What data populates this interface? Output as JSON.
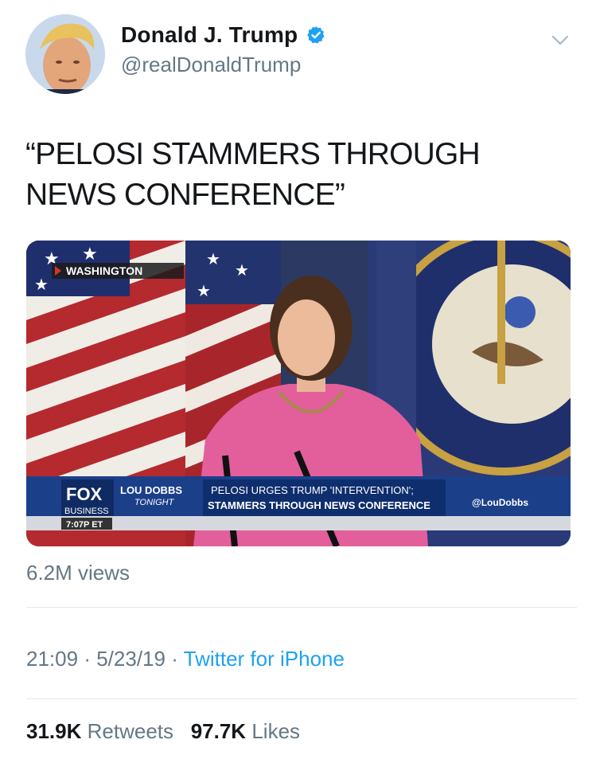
{
  "author": {
    "display_name": "Donald J. Trump",
    "handle": "@realDonaldTrump",
    "verified": true
  },
  "tweet": {
    "text_line1": "“PELOSI STAMMERS THROUGH",
    "text_line2": "NEWS CONFERENCE”"
  },
  "video": {
    "location_tag": "WASHINGTON",
    "network": "FOX",
    "network_sub": "BUSINESS",
    "time": "7:07P ET",
    "show_name_1": "LOU DOBBS",
    "show_name_2": "TONIGHT",
    "headline_1": "PELOSI URGES TRUMP 'INTERVENTION';",
    "headline_2": "STAMMERS THROUGH NEWS CONFERENCE",
    "twitter_handle": "@LouDobbs"
  },
  "views": "6.2M views",
  "meta": {
    "time": "21:09",
    "date": "5/23/19",
    "separator": "·",
    "source": "Twitter for iPhone"
  },
  "stats": {
    "retweets_count": "31.9K",
    "retweets_label": "Retweets",
    "likes_count": "97.7K",
    "likes_label": "Likes"
  },
  "colors": {
    "link_blue": "#1da1f2",
    "secondary_gray": "#657786",
    "divider": "#e1e8ed"
  }
}
